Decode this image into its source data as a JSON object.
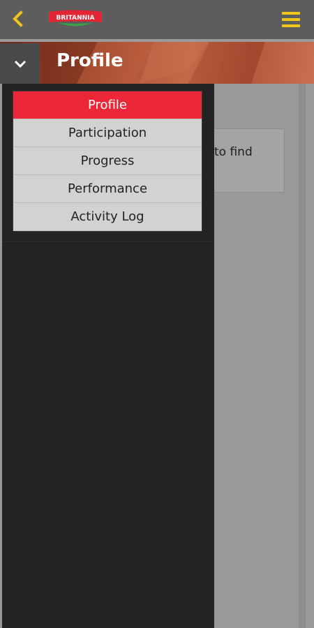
{
  "header": {
    "back_icon": "chevron-left-icon",
    "logo_text": "BRITANNIA",
    "menu_icon": "hamburger-icon",
    "accent_color": "#f0c419"
  },
  "title_bar": {
    "toggle_icon": "chevron-down-icon",
    "title": "Profile"
  },
  "content": {
    "card_text": "to find"
  },
  "dropdown": {
    "items": [
      {
        "label": "Profile",
        "active": true
      },
      {
        "label": "Participation",
        "active": false
      },
      {
        "label": "Progress",
        "active": false
      },
      {
        "label": "Performance",
        "active": false
      },
      {
        "label": "Activity Log",
        "active": false
      }
    ],
    "active_color": "#ec2838"
  }
}
